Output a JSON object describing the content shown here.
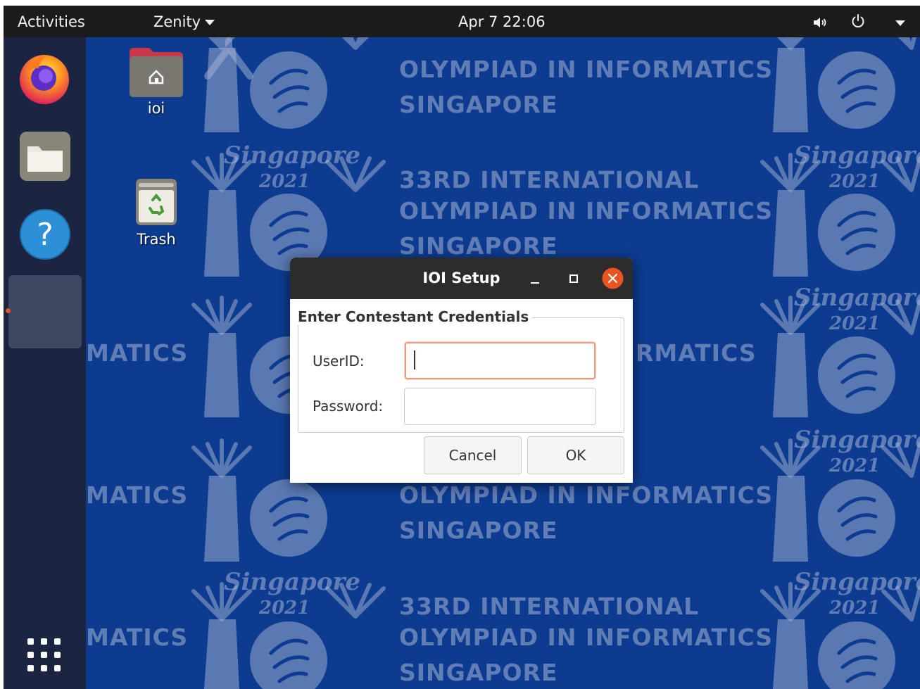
{
  "topbar": {
    "activities": "Activities",
    "app_menu": "Zenity",
    "clock": "Apr 7  22:06",
    "volume_icon": "volume-icon",
    "power_icon": "power-icon",
    "system_menu_icon": "chevron-down-icon"
  },
  "wallpaper": {
    "line_ordinal": "33RD INTERNATIONAL",
    "line_olympiad": "OLYMPIAD IN INFORMATICS",
    "line_country": "SINGAPORE",
    "script_city": "Singapore",
    "script_year": "2021",
    "fragment_ional": "IONAL",
    "fragment_rmat": "RMAT",
    "fragment_rmatics": "RMATICS",
    "fragment_informatics": "INFORMATICS",
    "fragment_onal": "ONAL",
    "fragment_nformat": "NFORMAT",
    "fragment_matics": "MATICS",
    "fragment_inf": "INF"
  },
  "dock": {
    "items": [
      {
        "name": "Firefox",
        "icon": "firefox-icon"
      },
      {
        "name": "Files",
        "icon": "files-icon"
      },
      {
        "name": "Help",
        "icon": "help-icon"
      },
      {
        "name": "Zenity window",
        "icon": "app-window-icon"
      }
    ],
    "show_apps_icon": "grid-icon"
  },
  "desktop": {
    "icons": [
      {
        "label": "ioi",
        "icon": "home-folder-icon"
      },
      {
        "label": "Trash",
        "icon": "trash-icon"
      }
    ]
  },
  "dialog": {
    "title": "IOI Setup",
    "frame_title": "Enter Contestant Credentials",
    "userid_label": "UserID:",
    "userid_value": "",
    "password_label": "Password:",
    "password_value": "",
    "cancel_label": "Cancel",
    "ok_label": "OK",
    "colors": {
      "close_button": "#e95420",
      "focus_border": "#e9967a",
      "titlebar": "#2c2c2c"
    }
  },
  "colors": {
    "wallpaper": "#0d3b8f",
    "topbar": "#1b1b1b",
    "dock": "#1c233a"
  }
}
